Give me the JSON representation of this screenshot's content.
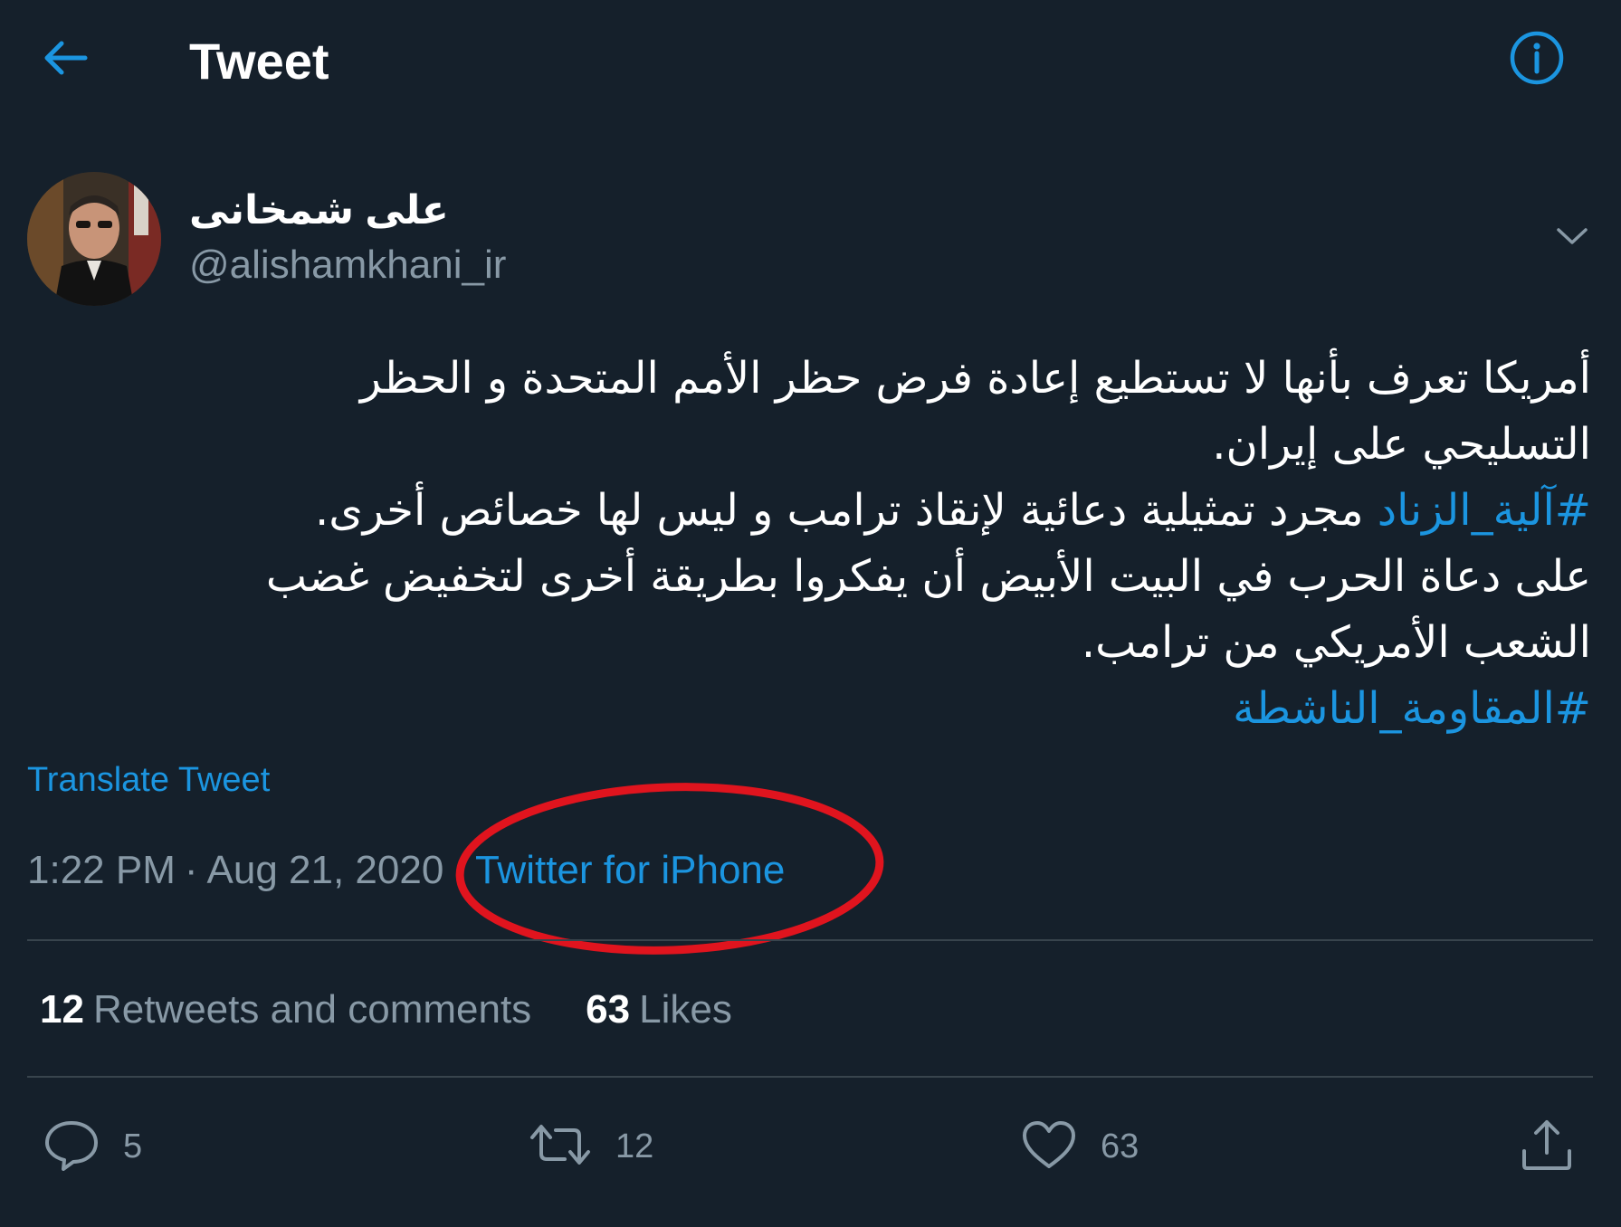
{
  "header": {
    "title": "Tweet"
  },
  "author": {
    "display_name": "على شمخانى",
    "handle": "@alishamkhani_ir"
  },
  "tweet": {
    "lines": [
      "أمريكا تعرف بأنها لا تستطيع إعادة فرض حظر الأمم المتحدة و الحظر",
      "التسليحي على إيران."
    ],
    "line3_hashtag": "#آلية_الزناد",
    "line3_text": " مجرد تمثيلية دعائية لإنقاذ ترامب و ليس لها خصائص أخرى.",
    "line4": "على دعاة الحرب في البيت الأبيض أن يفكروا بطريقة أخرى لتخفيض غضب",
    "line5": "الشعب الأمريكي من ترامب.",
    "final_hashtag": "#المقاومة_الناشطة",
    "translate_label": "Translate Tweet"
  },
  "meta": {
    "time": "1:22 PM",
    "separator": "·",
    "date": "Aug 21, 2020",
    "source": "Twitter for iPhone"
  },
  "stats": {
    "retweets_count": "12",
    "retweets_label": "Retweets and comments",
    "likes_count": "63",
    "likes_label": "Likes"
  },
  "actions": {
    "reply_count": "5",
    "retweet_count": "12",
    "like_count": "63"
  },
  "colors": {
    "background": "#15202b",
    "accent": "#1b95e0",
    "muted": "#8899a6",
    "annotation": "#e0141e"
  }
}
